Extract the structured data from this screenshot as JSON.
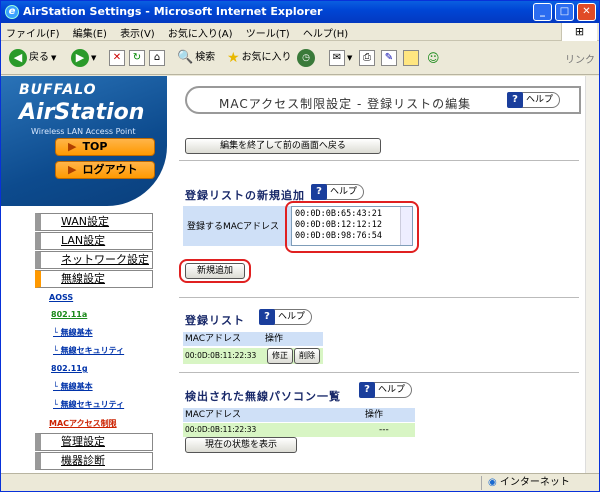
{
  "window": {
    "title": "AirStation Settings - Microsoft Internet Explorer"
  },
  "menubar": [
    "ファイル(F)",
    "編集(E)",
    "表示(V)",
    "お気に入り(A)",
    "ツール(T)",
    "ヘルプ(H)"
  ],
  "toolbar": {
    "back": "戻る",
    "search": "検索",
    "favorites": "お気に入り",
    "link": "リンク"
  },
  "sidebar": {
    "brand": "BUFFALO",
    "product": "AirStation",
    "tagline": "Wireless LAN Access Point",
    "top_button": "TOP",
    "logout_button": "ログアウト",
    "menu": [
      "WAN設定",
      "LAN設定",
      "ネットワーク設定",
      "無線設定",
      "管理設定",
      "機器診断"
    ],
    "sub": {
      "aoss": "AOSS",
      "a_head": "802.11a",
      "a_basic": "無線基本",
      "a_security": "無線セキュリティ",
      "g_head": "802.11g",
      "g_basic": "無線基本",
      "g_security": "無線セキュリティ",
      "mac_limit": "MACアクセス制限"
    }
  },
  "main": {
    "title": "MACアクセス制限設定 - 登録リストの編集",
    "help": "ヘルプ",
    "back_button": "編集を終了して前の画面へ戻る",
    "new_section": {
      "heading": "登録リストの新規追加",
      "field_label": "登録するMACアドレス",
      "macs": [
        "00:0D:0B:65:43:21",
        "00:0D:0B:12:12:12",
        "00:0D:0B:98:76:54"
      ],
      "add_button": "新規追加"
    },
    "reg_section": {
      "heading": "登録リスト",
      "col_mac": "MACアドレス",
      "col_op": "操作",
      "row_mac": "00:0D:0B:11:22:33",
      "edit": "修正",
      "delete": "削除"
    },
    "detect_section": {
      "heading": "検出された無線パソコン一覧",
      "col_mac": "MACアドレス",
      "col_op": "操作",
      "row_mac": "00:0D:0B:11:22:33",
      "row_op": "---",
      "show_button": "現在の状態を表示"
    }
  },
  "status": {
    "zone": "インターネット"
  },
  "colors": {
    "accent_orange": "#ff9900",
    "title_blue": "#0046d5",
    "highlight_red": "#e02020"
  }
}
